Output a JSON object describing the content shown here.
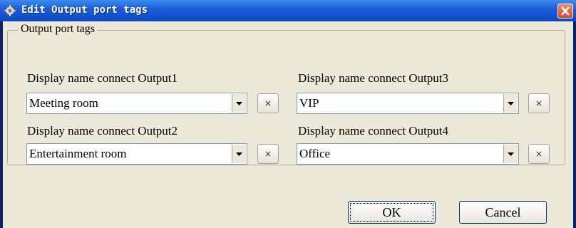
{
  "window": {
    "title": "Edit Output port tags"
  },
  "group": {
    "legend": "Output port tags",
    "fields": [
      {
        "label": "Display name connect Output1",
        "value": "Meeting room"
      },
      {
        "label": "Display name connect Output2",
        "value": "Entertainment room"
      },
      {
        "label": "Display name connect Output3",
        "value": "VIP"
      },
      {
        "label": "Display name connect Output4",
        "value": "Office"
      }
    ],
    "clear_button_label": "×"
  },
  "buttons": {
    "ok": "OK",
    "cancel": "Cancel"
  },
  "icons": {
    "title": "gear-icon",
    "close": "close-icon",
    "dropdown": "chevron-down-icon"
  },
  "colors": {
    "titlebar": "#0b47c4",
    "close": "#d6432a",
    "client": "#ece9d8"
  }
}
